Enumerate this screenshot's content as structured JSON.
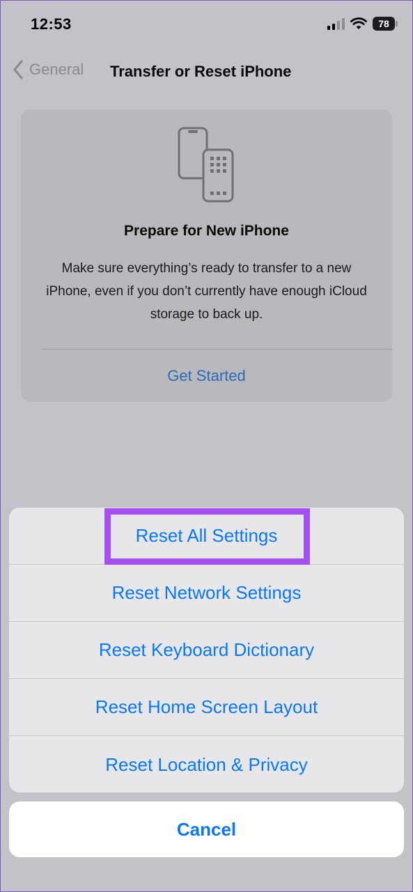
{
  "status_bar": {
    "time": "12:53",
    "battery": "78",
    "icons": [
      "signal-icon",
      "wifi-icon",
      "battery-icon"
    ]
  },
  "nav": {
    "back_label": "General",
    "title": "Transfer or Reset iPhone",
    "back_icon": "chevron-left-icon"
  },
  "prepare_card": {
    "icon": "phones-transfer-icon",
    "title": "Prepare for New iPhone",
    "body": "Make sure everything’s ready to transfer to a new iPhone, even if you don’t currently have enough iCloud storage to back up.",
    "action": "Get Started"
  },
  "action_sheet": {
    "items": [
      {
        "label": "Reset All Settings",
        "highlighted": true
      },
      {
        "label": "Reset Network Settings"
      },
      {
        "label": "Reset Keyboard Dictionary"
      },
      {
        "label": "Reset Home Screen Layout"
      },
      {
        "label": "Reset Location & Privacy"
      }
    ],
    "cancel": "Cancel"
  },
  "colors": {
    "accent": "#0a78f0",
    "highlight": "#a44ff2",
    "dimmed_background": "#c3c2c8"
  }
}
